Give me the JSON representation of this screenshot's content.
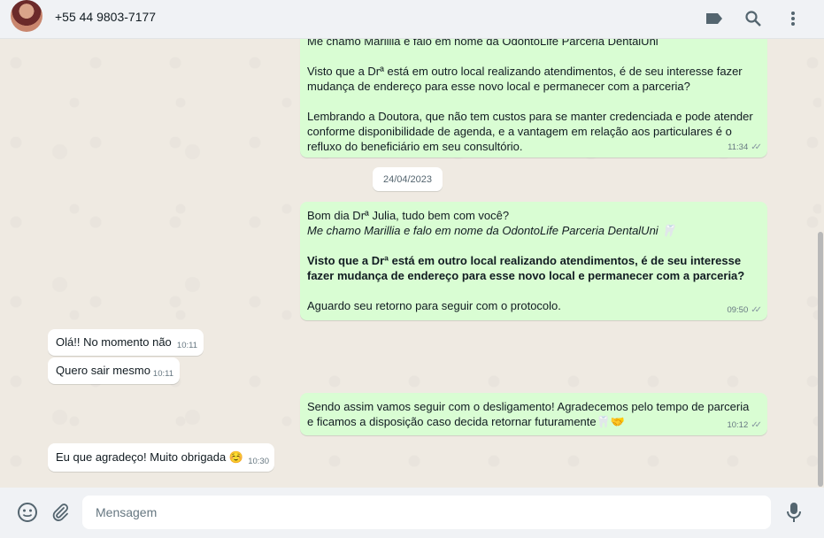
{
  "header": {
    "contact_phone": "+55 44 9803-7177",
    "icons": [
      "label-icon",
      "search-icon",
      "menu-icon"
    ]
  },
  "messages": {
    "m1": {
      "partial_top": "Me chamo Marillia e falo em nome da OdontoLife Parceria DentalUni",
      "p1": "Visto que a Drª está em outro local realizando atendimentos, é de seu interesse fazer mudança de endereço para esse novo local e permanecer com a parceria?",
      "p2": "Lembrando a Doutora, que não tem custos para se manter credenciada e pode atender conforme disponibilidade de agenda, e a vantagem em relação aos particulares é o refluxo do beneficiário em seu consultório.",
      "time": "11:34"
    },
    "date_separator": "24/04/2023",
    "m2": {
      "line1": "Bom dia Drª Julia, tudo bem com você?",
      "line2": "Me chamo Marillia e falo em nome da OdontoLife Parceria DentalUni 🦷",
      "bold": "Visto que a Drª está em outro local realizando atendimentos, é de seu interesse fazer mudança de endereço para esse novo local e permanecer com a parceria?",
      "line3": "Aguardo seu retorno para seguir com o protocolo.",
      "time": "09:50"
    },
    "m3": {
      "text": "Olá!! No momento não",
      "time": "10:11"
    },
    "m4": {
      "text": "Quero sair mesmo",
      "time": "10:11"
    },
    "m5": {
      "text": "Sendo assim vamos seguir com o desligamento! Agradecemos pelo tempo de parceria e ficamos a disposição caso decida retornar futuramente🦷🤝",
      "time": "10:12"
    },
    "m6": {
      "text": "Eu que agradeço! Muito obrigada ☺️",
      "time": "10:30"
    }
  },
  "footer": {
    "placeholder": "Mensagem",
    "icons": [
      "emoji-icon",
      "attach-icon",
      "microphone-icon"
    ]
  },
  "colors": {
    "outgoing_bubble": "#d9fdd3",
    "incoming_bubble": "#ffffff",
    "chat_background": "#efeae2",
    "header_background": "#f0f2f5"
  }
}
